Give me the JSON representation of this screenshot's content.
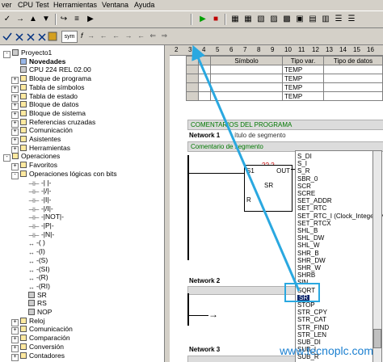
{
  "menu": [
    "ver",
    "CPU",
    "Test",
    "Herramientas",
    "Ventana",
    "Ayuda"
  ],
  "toolbar1": [
    "✓",
    "→",
    "▲",
    "▼",
    "↪",
    "≡",
    "▶",
    "■",
    "▦",
    "▦",
    "▧",
    "▨",
    "▩",
    "▣",
    "▤",
    "▥",
    "☰",
    "☰"
  ],
  "toolbar2_labels": {
    "sym": "sym",
    "f": "f",
    "arrows": "→ ← ← → ← ⇐ ⇒"
  },
  "tree": [
    {
      "label": "Proyecto1",
      "indent": 0,
      "icon": "project",
      "expand": "-"
    },
    {
      "label": "Novedades",
      "indent": 1,
      "icon": "help",
      "bold": true
    },
    {
      "label": "CPU 224 REL 02.00",
      "indent": 1,
      "icon": "cpu"
    },
    {
      "label": "Bloque de programa",
      "indent": 1,
      "icon": "folder",
      "expand": "+"
    },
    {
      "label": "Tabla de símbolos",
      "indent": 1,
      "icon": "folder",
      "expand": "+"
    },
    {
      "label": "Tabla de estado",
      "indent": 1,
      "icon": "folder",
      "expand": "+"
    },
    {
      "label": "Bloque de datos",
      "indent": 1,
      "icon": "folder",
      "expand": "+"
    },
    {
      "label": "Bloque de sistema",
      "indent": 1,
      "icon": "folder",
      "expand": "+"
    },
    {
      "label": "Referencias cruzadas",
      "indent": 1,
      "icon": "folder",
      "expand": "+"
    },
    {
      "label": "Comunicación",
      "indent": 1,
      "icon": "folder",
      "expand": "+"
    },
    {
      "label": "Asistentes",
      "indent": 1,
      "icon": "folder",
      "expand": "+"
    },
    {
      "label": "Herramientas",
      "indent": 1,
      "icon": "folder",
      "expand": "+"
    },
    {
      "label": "Operaciones",
      "indent": 0,
      "icon": "folder",
      "expand": "-"
    },
    {
      "label": "Favoritos",
      "indent": 1,
      "icon": "folder",
      "expand": "+"
    },
    {
      "label": "Operaciones lógicas con bits",
      "indent": 1,
      "icon": "folder",
      "expand": "-"
    },
    {
      "label": "-| |-",
      "indent": 2,
      "icon": "contact"
    },
    {
      "label": "-|/|-",
      "indent": 2,
      "icon": "contact"
    },
    {
      "label": "-|I|-",
      "indent": 2,
      "icon": "contact"
    },
    {
      "label": "-|/I|-",
      "indent": 2,
      "icon": "contact"
    },
    {
      "label": "-|NOT|-",
      "indent": 2,
      "icon": "contact"
    },
    {
      "label": "-|P|-",
      "indent": 2,
      "icon": "contact"
    },
    {
      "label": "-|N|-",
      "indent": 2,
      "icon": "contact"
    },
    {
      "label": "-( )",
      "indent": 2,
      "icon": "coil"
    },
    {
      "label": "-(I)",
      "indent": 2,
      "icon": "coil"
    },
    {
      "label": "-(S)",
      "indent": 2,
      "icon": "coil"
    },
    {
      "label": "-(SI)",
      "indent": 2,
      "icon": "coil"
    },
    {
      "label": "-(R)",
      "indent": 2,
      "icon": "coil"
    },
    {
      "label": "-(RI)",
      "indent": 2,
      "icon": "coil"
    },
    {
      "label": "SR",
      "indent": 2,
      "icon": "box"
    },
    {
      "label": "RS",
      "indent": 2,
      "icon": "box"
    },
    {
      "label": "NOP",
      "indent": 2,
      "icon": "box"
    },
    {
      "label": "Reloj",
      "indent": 1,
      "icon": "folder",
      "expand": "+"
    },
    {
      "label": "Comunicación",
      "indent": 1,
      "icon": "folder",
      "expand": "+"
    },
    {
      "label": "Comparación",
      "indent": 1,
      "icon": "folder",
      "expand": "+"
    },
    {
      "label": "Conversión",
      "indent": 1,
      "icon": "folder",
      "expand": "+"
    },
    {
      "label": "Contadores",
      "indent": 1,
      "icon": "folder",
      "expand": "+"
    }
  ],
  "ruler": [
    "2",
    "3",
    "4",
    "5",
    "6",
    "7",
    "8",
    "9",
    "10",
    "11",
    "12",
    "13",
    "14",
    "15",
    "16"
  ],
  "vartable": {
    "headers": [
      "Símbolo",
      "Tipo var.",
      "Tipo de datos"
    ],
    "rows": [
      [
        "",
        "TEMP",
        ""
      ],
      [
        "",
        "TEMP",
        ""
      ],
      [
        "",
        "TEMP",
        ""
      ],
      [
        "",
        "TEMP",
        ""
      ]
    ]
  },
  "program": {
    "comments_title": "COMENTARIOS DEL PROGRAMA",
    "network1": "Network 1",
    "network1_title": "ítulo de segmento",
    "segment_comment": "Comentario de segmento",
    "box_param": "??.?",
    "box_name": "SR",
    "box_s1": "S1",
    "box_out": "OUT",
    "box_r": "R",
    "network2": "Network 2",
    "network3": "Network 3"
  },
  "instruction_list": [
    "S_DI",
    "S_I",
    "S_R",
    "SBR_0",
    "SCR",
    "SCRE",
    "SET_ADDR",
    "SET_RTC",
    "SET_RTC_I (Clock_Integer (v",
    "SET_RTCX",
    "SHL_B",
    "SHL_DW",
    "SHL_W",
    "SHR_B",
    "SHR_DW",
    "SHR_W",
    "SHRB",
    "SIN",
    "SQRT",
    "SR",
    "STOP",
    "STR_CPY",
    "STR_CAT",
    "STR_FIND",
    "STR_LEN",
    "SUB_DI",
    "SUB_I",
    "SUB_R"
  ],
  "selected_instruction": "SR",
  "watermark": "www.tecnoplc.com",
  "colors": {
    "highlight": "#2aa8e0",
    "arrow": "#2aa8e0",
    "comment_green": "#007700"
  }
}
